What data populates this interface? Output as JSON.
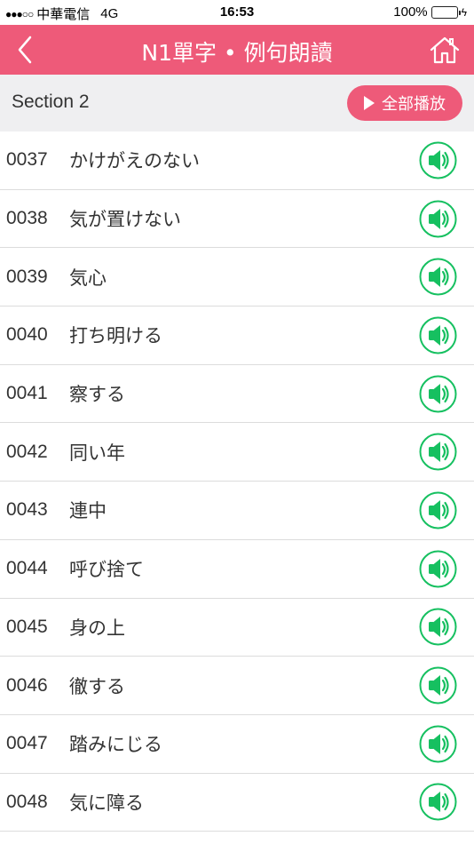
{
  "status_bar": {
    "signal": "●●●○○",
    "carrier": "中華電信",
    "network": "4G",
    "time": "16:53",
    "battery": "100%"
  },
  "nav": {
    "title": "N1單字 • 例句朗讀",
    "back_icon": "chevron-left-icon",
    "home_icon": "home-icon"
  },
  "section": {
    "title": "Section 2",
    "play_all_label": "全部播放"
  },
  "colors": {
    "accent": "#ee5a79",
    "speaker_green": "#16c060",
    "header_bg": "#efeff1"
  },
  "items": [
    {
      "num": "0037",
      "word": "かけがえのない"
    },
    {
      "num": "0038",
      "word": "気が置けない"
    },
    {
      "num": "0039",
      "word": "気心"
    },
    {
      "num": "0040",
      "word": "打ち明ける"
    },
    {
      "num": "0041",
      "word": "察する"
    },
    {
      "num": "0042",
      "word": "同い年"
    },
    {
      "num": "0043",
      "word": "連中"
    },
    {
      "num": "0044",
      "word": "呼び捨て"
    },
    {
      "num": "0045",
      "word": "身の上"
    },
    {
      "num": "0046",
      "word": "徹する"
    },
    {
      "num": "0047",
      "word": "踏みにじる"
    },
    {
      "num": "0048",
      "word": "気に障る"
    }
  ]
}
